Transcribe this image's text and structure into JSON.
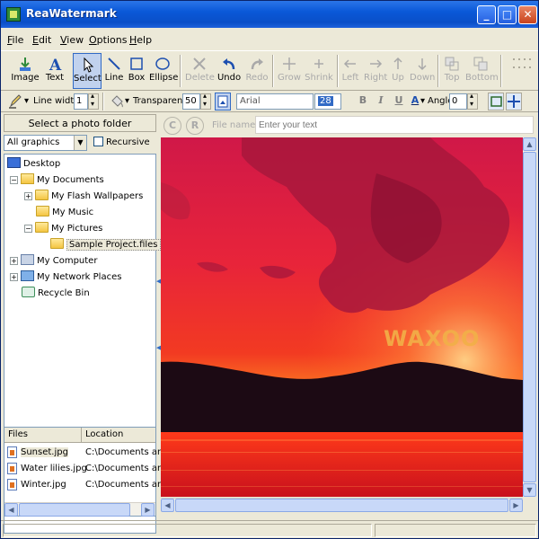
{
  "window": {
    "title": "ReaWatermark"
  },
  "menu": [
    {
      "label": "File",
      "ul": "F",
      "rest": "ile"
    },
    {
      "label": "Edit",
      "ul": "E",
      "rest": "dit"
    },
    {
      "label": "View",
      "ul": "V",
      "rest": "iew"
    },
    {
      "label": "Options",
      "ul": "O",
      "rest": "ptions"
    },
    {
      "label": "Help",
      "ul": "H",
      "rest": "elp"
    }
  ],
  "toolbar": {
    "image": "Image",
    "text": "Text",
    "select": "Select",
    "line": "Line",
    "box": "Box",
    "ellipse": "Ellipse",
    "delete": "Delete",
    "undo": "Undo",
    "redo": "Redo",
    "grow": "Grow",
    "shrink": "Shrink",
    "left": "Left",
    "right": "Right",
    "up": "Up",
    "down": "Down",
    "top": "Top",
    "bottom": "Bottom"
  },
  "format": {
    "line_width_label": "Line width",
    "line_width_value": "1",
    "transparency_label": "Transparency",
    "transparency_value": "50",
    "font": "Arial",
    "font_size": "28",
    "bold": "B",
    "italic": "I",
    "underline": "U",
    "color": "A",
    "angle_label": "Angle",
    "angle_value": "0"
  },
  "left": {
    "folder_button": "Select a photo folder",
    "filter": "All graphics",
    "recursive_label": "Recursive",
    "tree": {
      "desktop": "Desktop",
      "my_documents": "My Documents",
      "flash_wallpapers": "My Flash Wallpapers",
      "my_music": "My Music",
      "my_pictures": "My Pictures",
      "sample_project": "Sample Project.files",
      "my_computer": "My Computer",
      "network_places": "My Network Places",
      "recycle_bin": "Recycle Bin"
    },
    "files": {
      "col_files": "Files",
      "col_location": "Location",
      "rows": [
        {
          "name": "Sunset.jpg",
          "location": "C:\\Documents and"
        },
        {
          "name": "Water lilies.jpg",
          "location": "C:\\Documents and"
        },
        {
          "name": "Winter.jpg",
          "location": "C:\\Documents and"
        }
      ]
    }
  },
  "right": {
    "copyright_btn": "C",
    "registered_btn": "R",
    "filename_label": "File name",
    "text_placeholder": "Enter your text",
    "watermark_text": "WAXOO"
  },
  "colors": {
    "titlebar": "#0a58d8",
    "sky_top": "#d31a48",
    "sky_mid": "#f02a20",
    "watermark": "#f2b048"
  }
}
